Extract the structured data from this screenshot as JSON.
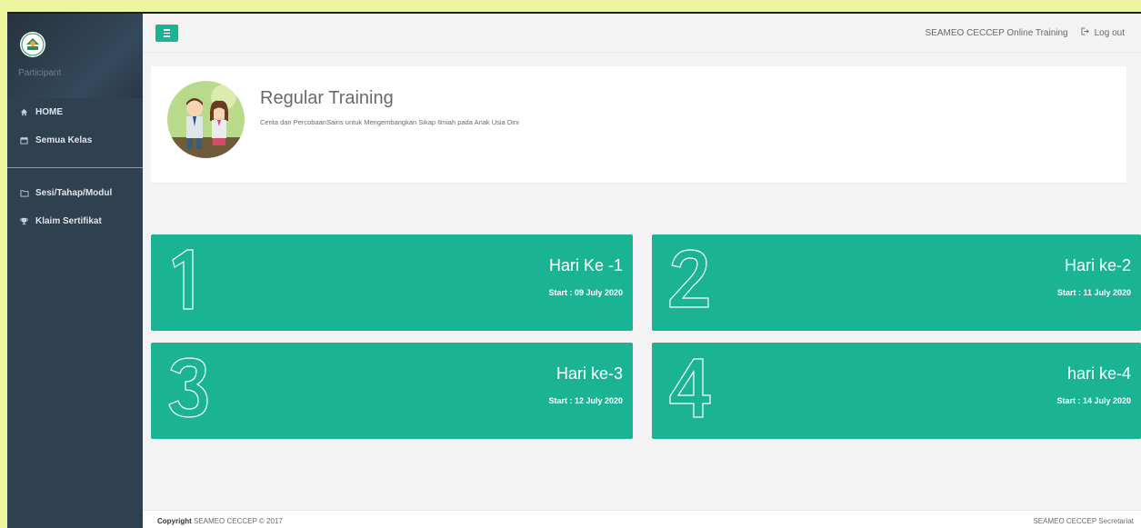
{
  "sidebar": {
    "role": "Participant",
    "items_top": [
      {
        "label": "HOME",
        "icon": "home-icon"
      },
      {
        "label": "Semua Kelas",
        "icon": "calendar-icon"
      }
    ],
    "items_bottom": [
      {
        "label": "Sesi/Tahap/Modul",
        "icon": "folder-icon"
      },
      {
        "label": "Klaim Sertifikat",
        "icon": "trophy-icon"
      }
    ]
  },
  "topbar": {
    "site_name": "SEAMEO CECCEP Online Training",
    "logout_label": "Log out"
  },
  "course": {
    "title": "Regular Training",
    "subtitle": "Cerita dan PercobaanSains untuk Mengembangkan Sikap Ilmiah pada Anak Usia Dini"
  },
  "days": [
    {
      "number": "1",
      "title": "Hari Ke -1",
      "start": "Start : 09 July 2020"
    },
    {
      "number": "2",
      "title": "Hari ke-2",
      "start": "Start : 11 July 2020"
    },
    {
      "number": "3",
      "title": "Hari ke-3",
      "start": "Start : 12 July 2020"
    },
    {
      "number": "4",
      "title": "hari ke-4",
      "start": "Start : 14 July 2020"
    }
  ],
  "footer": {
    "copyright_bold": "Copyright",
    "copyright_text": " SEAMEO CECCEP © 2017",
    "right": "SEAMEO CECCEP Secretariat"
  },
  "colors": {
    "accent": "#1ab394",
    "sidebar": "#2f4050",
    "page_bg": "#f3f3f4",
    "outer_bg": "#eef59f"
  }
}
